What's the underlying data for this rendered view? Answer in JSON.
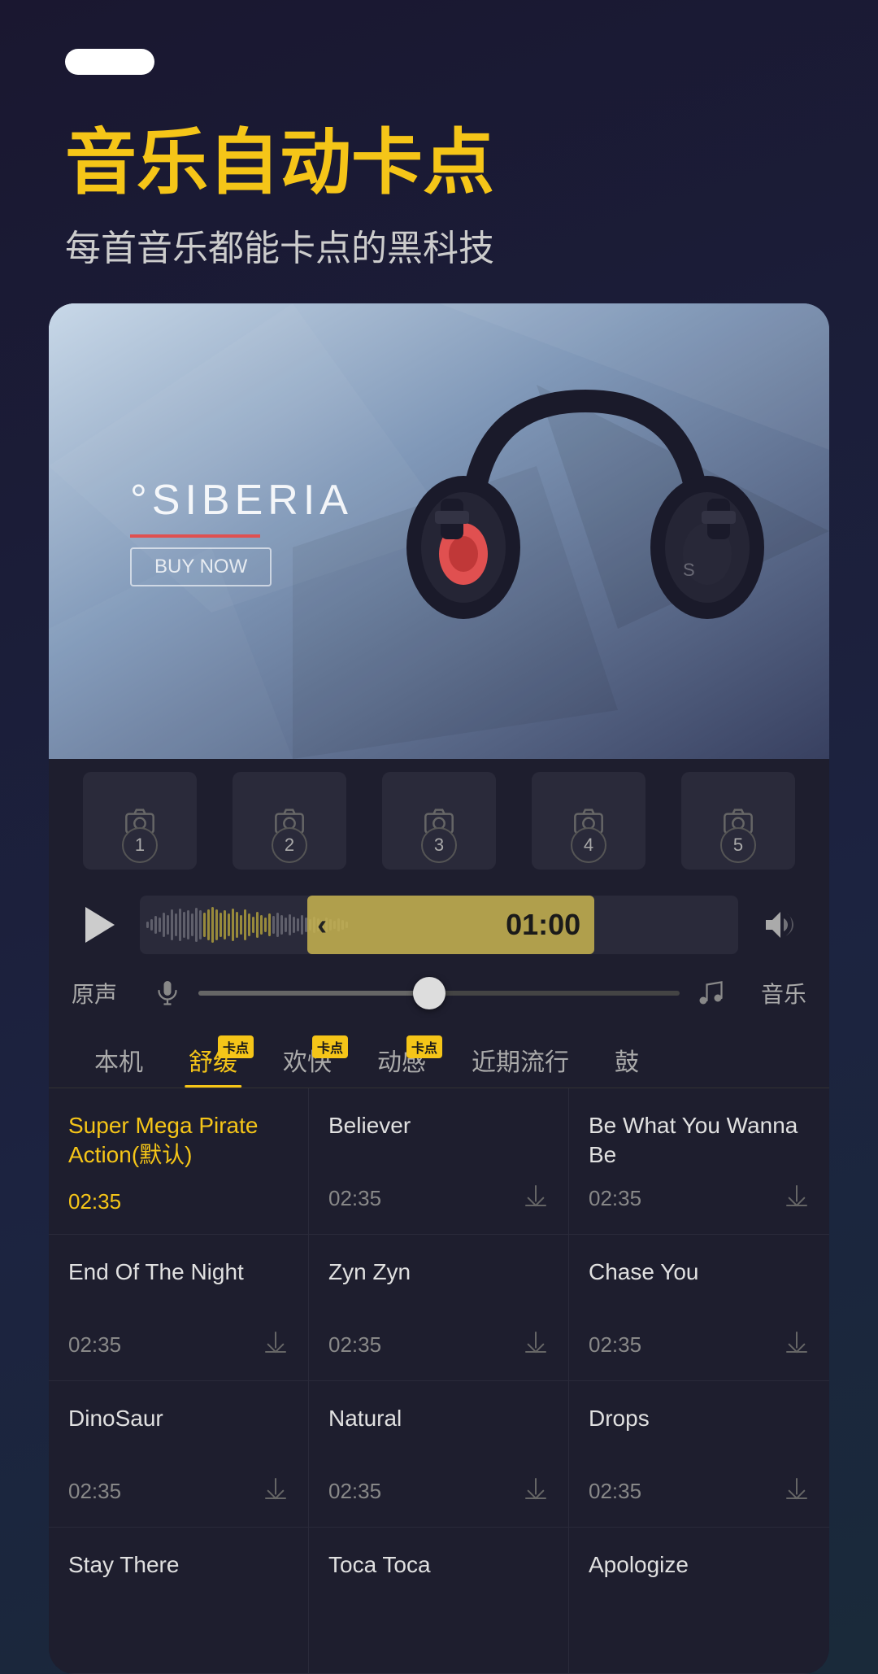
{
  "statusBar": {
    "pill": ""
  },
  "header": {
    "title": "音乐自动卡点",
    "subtitle": "每首音乐都能卡点的黑科技"
  },
  "hero": {
    "brand": "°SIBERIA",
    "tagline": "BUY NOW"
  },
  "thumbnails": [
    {
      "num": "1"
    },
    {
      "num": "2"
    },
    {
      "num": "3"
    },
    {
      "num": "4"
    },
    {
      "num": "5"
    }
  ],
  "playback": {
    "time": "01:00",
    "play_label": "play"
  },
  "voiceMusic": {
    "voice_label": "原声",
    "music_label": "音乐"
  },
  "tabs": [
    {
      "label": "本机",
      "active": false,
      "badge": false
    },
    {
      "label": "舒缓",
      "active": true,
      "badge": true
    },
    {
      "label": "欢快",
      "active": false,
      "badge": true
    },
    {
      "label": "动感",
      "active": false,
      "badge": true
    },
    {
      "label": "近期流行",
      "active": false,
      "badge": false
    },
    {
      "label": "鼓",
      "active": false,
      "badge": false
    }
  ],
  "songs": [
    {
      "name": "Super Mega Pirate Action(默认)",
      "duration": "02:35",
      "active": true,
      "download": false
    },
    {
      "name": "Believer",
      "duration": "02:35",
      "active": false,
      "download": true
    },
    {
      "name": "Be What You Wanna Be",
      "duration": "02:35",
      "active": false,
      "download": true
    },
    {
      "name": "End Of The Night",
      "duration": "02:35",
      "active": false,
      "download": true
    },
    {
      "name": "Zyn Zyn",
      "duration": "02:35",
      "active": false,
      "download": true
    },
    {
      "name": "Chase You",
      "duration": "02:35",
      "active": false,
      "download": true
    },
    {
      "name": "DinoSaur",
      "duration": "02:35",
      "active": false,
      "download": true
    },
    {
      "name": "Natural",
      "duration": "02:35",
      "active": false,
      "download": true
    },
    {
      "name": "Drops",
      "duration": "02:35",
      "active": false,
      "download": true
    },
    {
      "name": "Stay There",
      "duration": "",
      "active": false,
      "download": false
    },
    {
      "name": "Toca Toca",
      "duration": "",
      "active": false,
      "download": false
    },
    {
      "name": "Apologize",
      "duration": "",
      "active": false,
      "download": false
    }
  ]
}
